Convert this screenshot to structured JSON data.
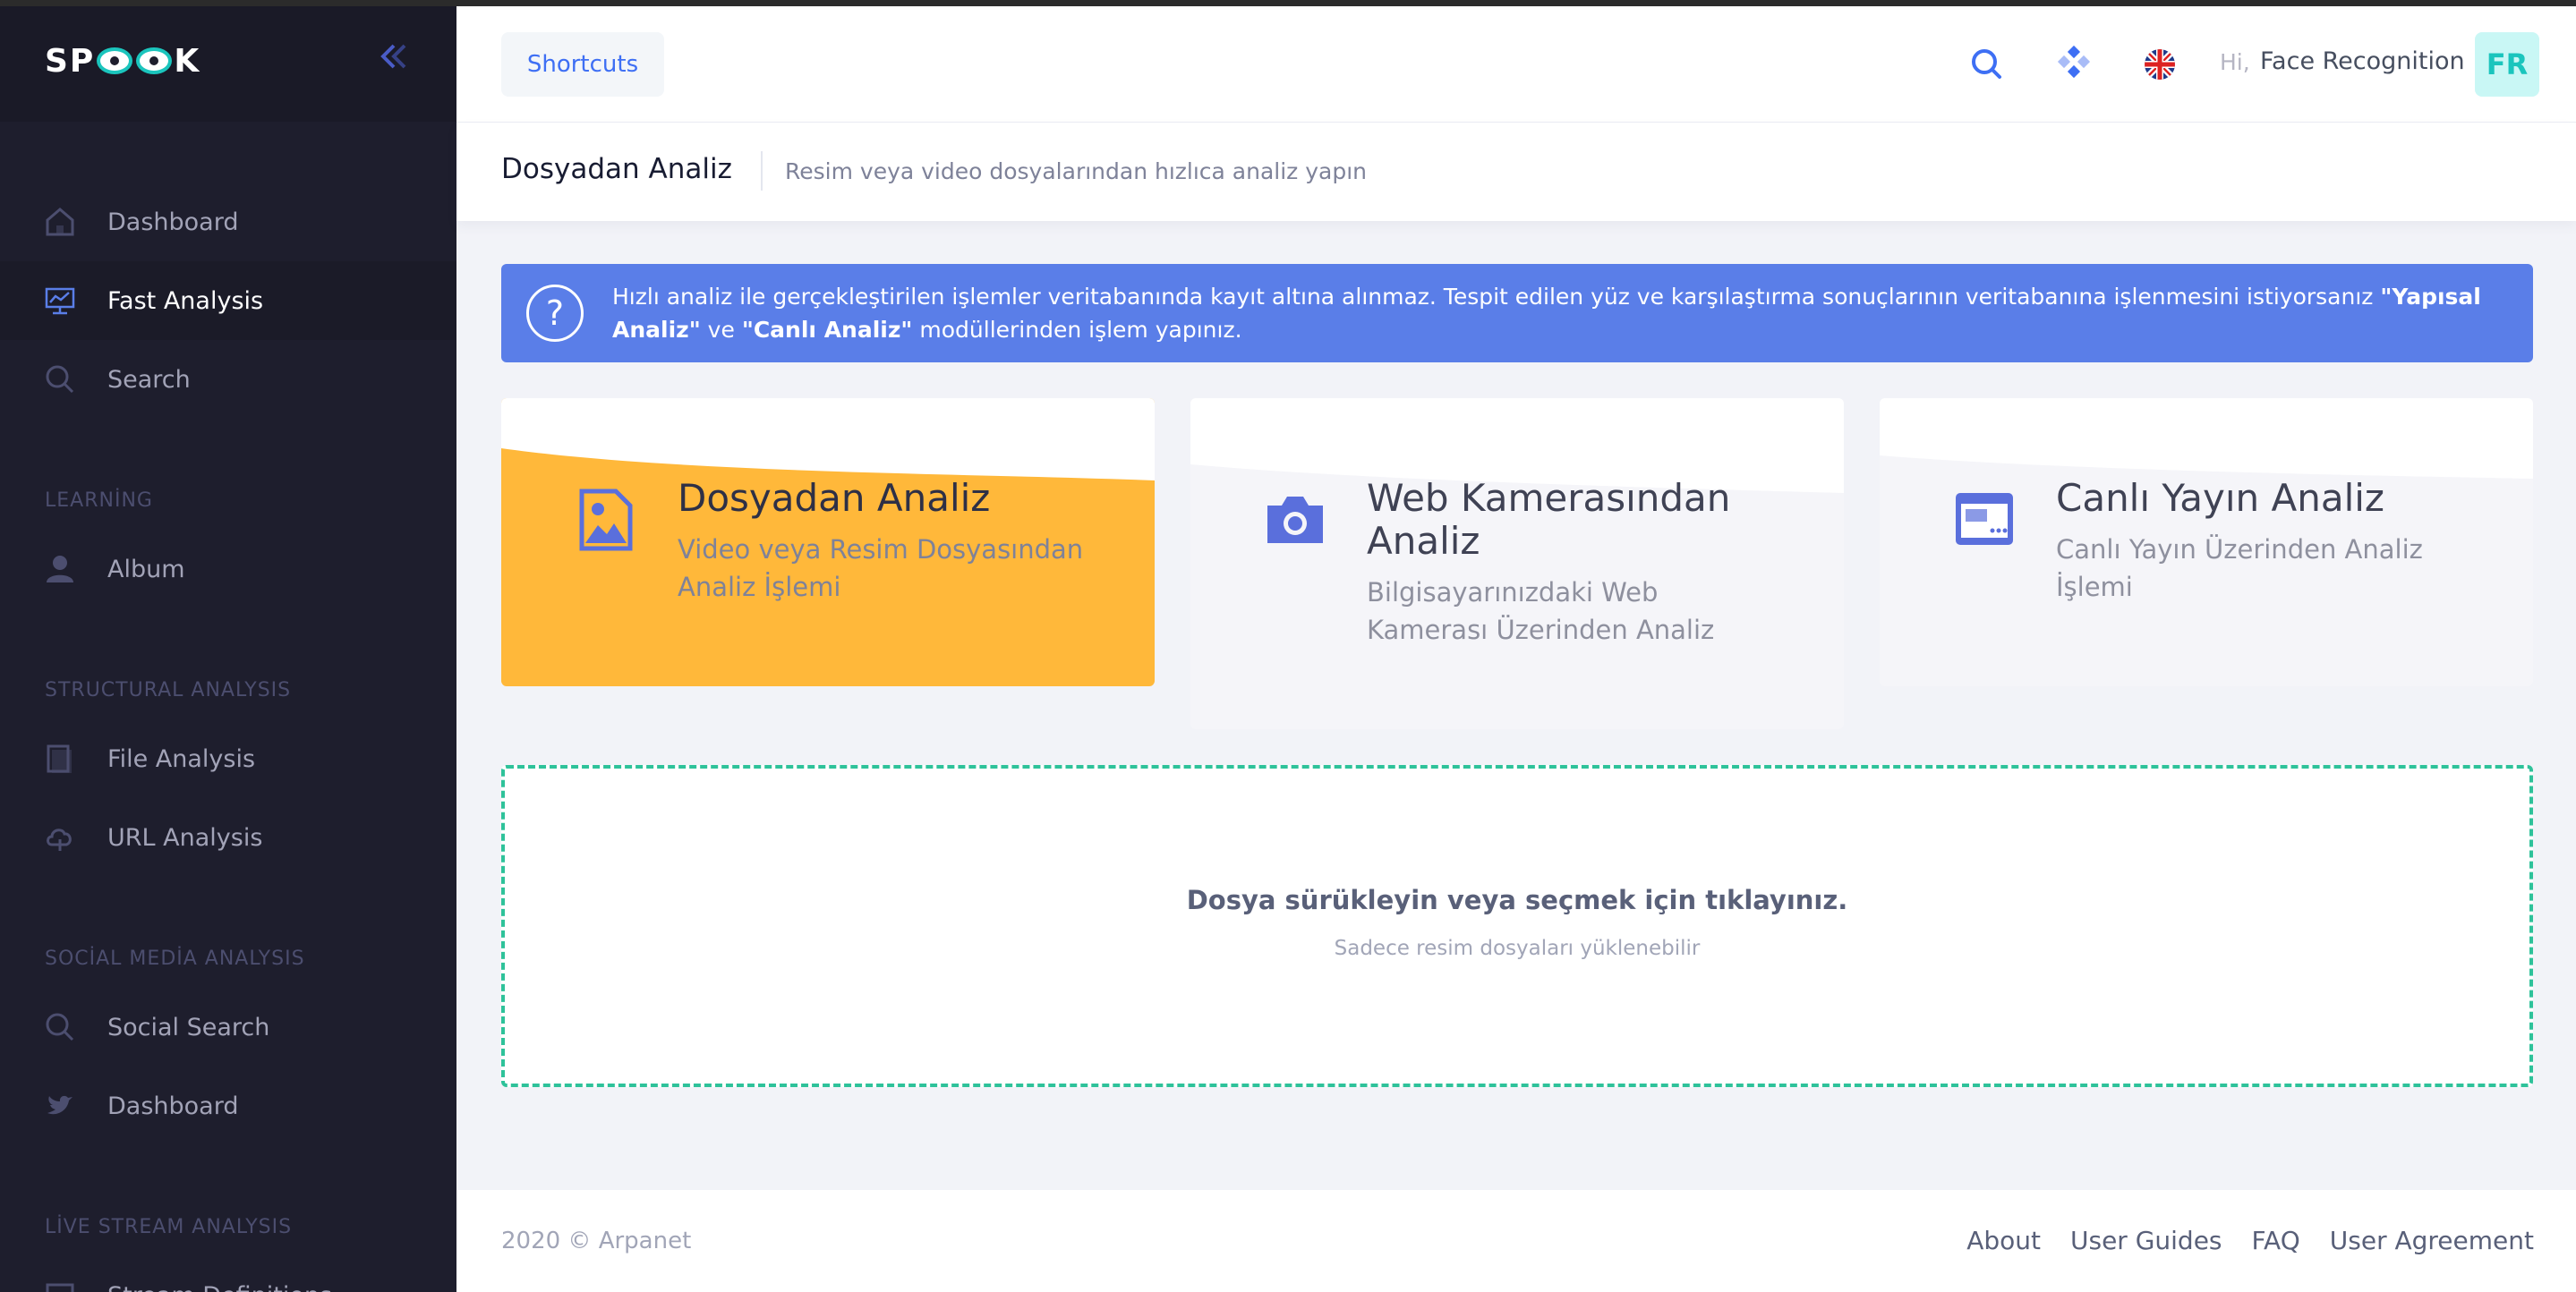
{
  "brand": {
    "logo_text_left": "SP",
    "logo_text_right": "K"
  },
  "sidebar": {
    "items": [
      {
        "label": "Dashboard",
        "icon": "home-icon"
      },
      {
        "label": "Fast Analysis",
        "icon": "chart-icon",
        "active": true
      },
      {
        "label": "Search",
        "icon": "search-icon"
      }
    ],
    "sections": [
      {
        "title": "LEARNİNG",
        "items": [
          {
            "label": "Album",
            "icon": "user-icon"
          }
        ]
      },
      {
        "title": "STRUCTURAL ANALYSIS",
        "items": [
          {
            "label": "File Analysis",
            "icon": "file-icon"
          },
          {
            "label": "URL Analysis",
            "icon": "cloud-icon"
          }
        ]
      },
      {
        "title": "SOCİAL MEDİA ANALYSIS",
        "items": [
          {
            "label": "Social Search",
            "icon": "search-icon"
          },
          {
            "label": "Dashboard",
            "icon": "twitter-icon"
          }
        ]
      },
      {
        "title": "LİVE STREAM ANALYSIS",
        "items": [
          {
            "label": "Stream Definitions",
            "icon": "stream-icon"
          }
        ]
      }
    ]
  },
  "header": {
    "shortcuts_label": "Shortcuts",
    "greeting": "Hi,",
    "user_name": "Face Recognition",
    "avatar_initials": "FR"
  },
  "subheader": {
    "title": "Dosyadan Analiz",
    "description": "Resim veya video dosyalarından hızlıca analiz yapın"
  },
  "alert": {
    "text_before": "Hızlı analiz ile gerçekleştirilen işlemler veritabanında kayıt altına alınmaz. Tespit edilen yüz ve karşılaştırma sonuçlarının veritabanına işlenmesini istiyorsanız ",
    "bold_1": "\"Yapısal Analiz\"",
    "text_mid": " ve ",
    "bold_2": "\"Canlı Analiz\"",
    "text_after": " modüllerinden işlem yapınız."
  },
  "cards": [
    {
      "title": "Dosyadan Analiz",
      "description": "Video veya Resim Dosyasından Analiz İşlemi",
      "icon": "image-file-icon"
    },
    {
      "title": "Web Kamerasından Analiz",
      "description": "Bilgisayarınızdaki Web Kamerası Üzerinden Analiz",
      "icon": "camera-icon"
    },
    {
      "title": "Canlı Yayın Analiz",
      "description": "Canlı Yayın Üzerinden Analiz İşlemi",
      "icon": "browser-window-icon"
    }
  ],
  "dropzone": {
    "title": "Dosya sürükleyin veya seçmek için tıklayınız.",
    "subtitle": "Sadece resim dosyaları yüklenebilir"
  },
  "footer": {
    "copyright": "2020 © Arpanet",
    "links": [
      "About",
      "User Guides",
      "FAQ",
      "User Agreement"
    ]
  },
  "colors": {
    "sidebar_bg": "#1e1e2d",
    "accent_blue": "#5a7ee8",
    "active_card": "#ffb83a",
    "dropzone_border": "#2ec29a",
    "avatar_text": "#1bc5bd"
  }
}
